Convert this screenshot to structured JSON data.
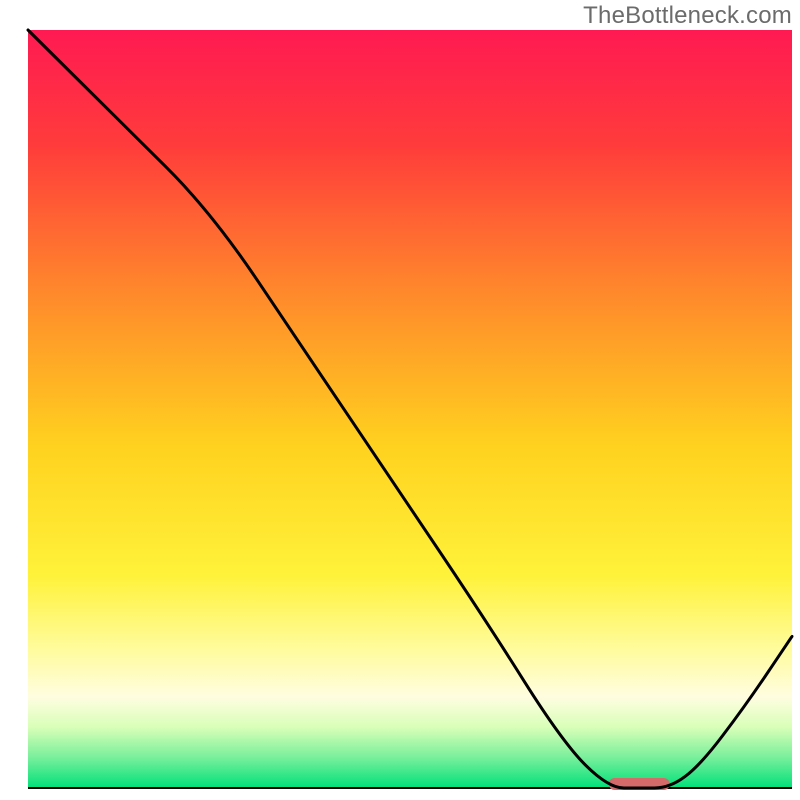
{
  "watermark": "TheBottleneck.com",
  "chart_data": {
    "type": "line",
    "title": "",
    "xlabel": "",
    "ylabel": "",
    "xlim": [
      0,
      100
    ],
    "ylim": [
      0,
      100
    ],
    "legend": false,
    "grid": false,
    "background": {
      "description": "Vertical gradient representing bottleneck severity (red=high, green=low)",
      "stops": [
        {
          "offset": 0.0,
          "color": "#ff1a52"
        },
        {
          "offset": 0.15,
          "color": "#ff3b3b"
        },
        {
          "offset": 0.35,
          "color": "#ff8a2b"
        },
        {
          "offset": 0.55,
          "color": "#ffd21f"
        },
        {
          "offset": 0.72,
          "color": "#fff23a"
        },
        {
          "offset": 0.82,
          "color": "#fffca0"
        },
        {
          "offset": 0.88,
          "color": "#fffde0"
        },
        {
          "offset": 0.92,
          "color": "#d8ffb8"
        },
        {
          "offset": 0.96,
          "color": "#78ef9b"
        },
        {
          "offset": 1.0,
          "color": "#00e07a"
        }
      ]
    },
    "series": [
      {
        "name": "bottleneck-curve",
        "color": "#000000",
        "x": [
          0,
          12,
          24,
          36,
          48,
          60,
          70,
          76,
          80,
          84,
          88,
          94,
          100
        ],
        "values": [
          100,
          88,
          76,
          58,
          40,
          22,
          6,
          0,
          0,
          0,
          3,
          11,
          20
        ]
      }
    ],
    "marker": {
      "name": "optimal-range-marker",
      "color": "#d46a6a",
      "x_start": 76,
      "x_end": 84,
      "y": 0,
      "thickness_px": 12
    }
  }
}
